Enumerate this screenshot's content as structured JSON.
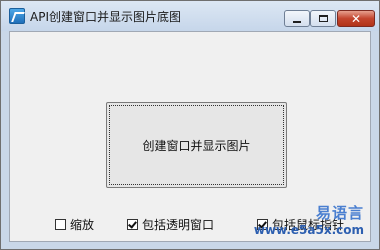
{
  "window": {
    "title": "API创建窗口并显示图片底图",
    "controls": {
      "minimize": "minimize",
      "maximize": "maximize",
      "close": "✕"
    }
  },
  "main": {
    "button_label": "创建窗口并显示图片"
  },
  "checkboxes": [
    {
      "label": "缩放",
      "checked": false
    },
    {
      "label": "包括透明窗口",
      "checked": true
    },
    {
      "label": "包括鼠标指针",
      "checked": true
    }
  ],
  "watermark": {
    "brand": "易语言",
    "url": "www.e5a5x.com"
  },
  "colors": {
    "titlebar": "#c6d6ea",
    "client_bg": "#f0f0f0",
    "close_button": "#c3452e"
  }
}
